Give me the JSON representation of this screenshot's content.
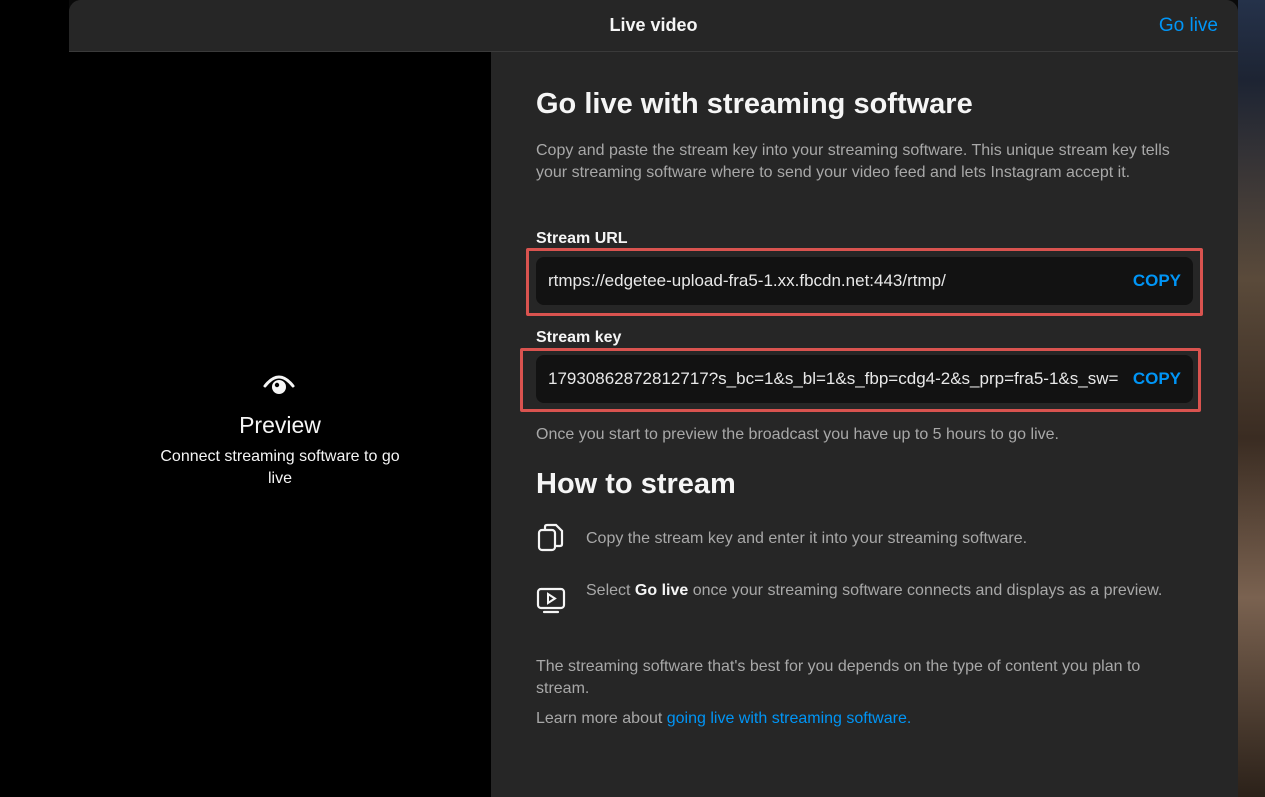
{
  "header": {
    "title": "Live video",
    "go_live_label": "Go live"
  },
  "preview": {
    "icon": "eye-icon",
    "title": "Preview",
    "subtitle": "Connect streaming software to go live"
  },
  "main": {
    "heading": "Go live with streaming software",
    "description": "Copy and paste the stream key into your streaming software. This unique stream key tells your streaming software where to send your video feed and lets Instagram accept it.",
    "stream_url": {
      "label": "Stream URL",
      "value": "rtmps://edgetee-upload-fra5-1.xx.fbcdn.net:443/rtmp/",
      "copy_label": "COPY"
    },
    "stream_key": {
      "label": "Stream key",
      "value": "17930862872812717?s_bc=1&s_bl=1&s_fbp=cdg4-2&s_prp=fra5-1&s_sw=",
      "copy_label": "COPY"
    },
    "note": "Once you start to preview the broadcast you have up to 5 hours to go live."
  },
  "how_to": {
    "heading": "How to stream",
    "steps": [
      {
        "icon": "copy-icon",
        "text": "Copy the stream key and enter it into your streaming software."
      },
      {
        "icon": "play-screen-icon",
        "prefix": "Select ",
        "bold": "Go live",
        "suffix": " once your streaming software connects and displays as a preview."
      }
    ],
    "footer_text": "The streaming software that's best for you depends on the type of content you plan to stream.",
    "learn_more_prefix": "Learn more about ",
    "learn_more_link": "going live with streaming software."
  },
  "colors": {
    "accent": "#0095f6",
    "highlight": "#d9534f",
    "panel": "#262626"
  }
}
